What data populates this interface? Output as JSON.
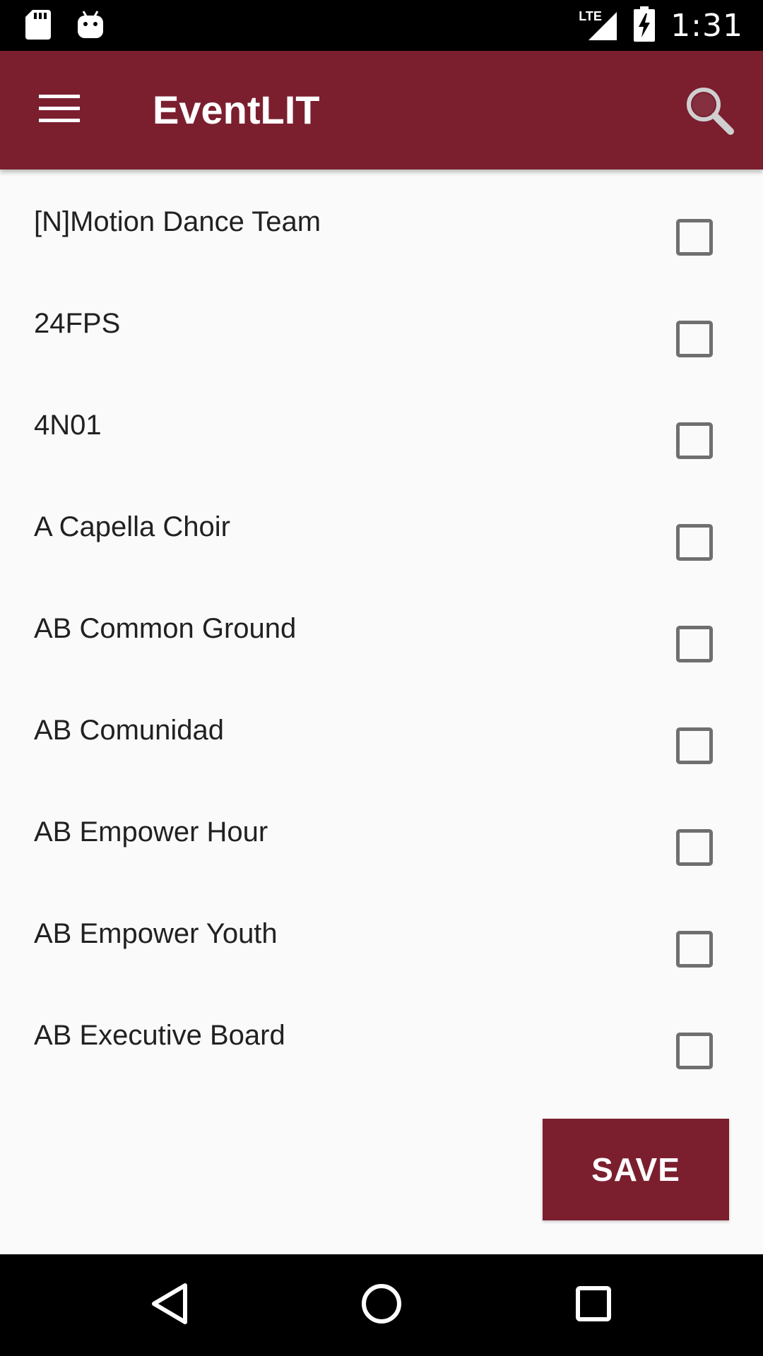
{
  "status_bar": {
    "time": "1:31",
    "network": "LTE",
    "icons": [
      "sd-card-icon",
      "android-debug-icon",
      "lte-signal-icon",
      "battery-charging-icon"
    ]
  },
  "app_bar": {
    "title": "EventLIT",
    "menu_icon": "hamburger-menu-icon",
    "search_icon": "search-icon"
  },
  "list": {
    "items": [
      {
        "label": "[N]Motion Dance Team",
        "checked": false
      },
      {
        "label": "24FPS",
        "checked": false
      },
      {
        "label": "4N01",
        "checked": false
      },
      {
        "label": "A Capella Choir",
        "checked": false
      },
      {
        "label": "AB Common Ground",
        "checked": false
      },
      {
        "label": "AB Comunidad",
        "checked": false
      },
      {
        "label": "AB Empower Hour",
        "checked": false
      },
      {
        "label": "AB Empower Youth",
        "checked": false
      },
      {
        "label": "AB Executive Board",
        "checked": false
      }
    ]
  },
  "actions": {
    "save_label": "SAVE"
  },
  "nav_bar": {
    "icons": [
      "back-icon",
      "home-icon",
      "recents-icon"
    ]
  },
  "colors": {
    "primary": "#7b1f2f",
    "background": "#fafafa",
    "text": "#212121",
    "checkbox_border": "#6f6f6f"
  }
}
